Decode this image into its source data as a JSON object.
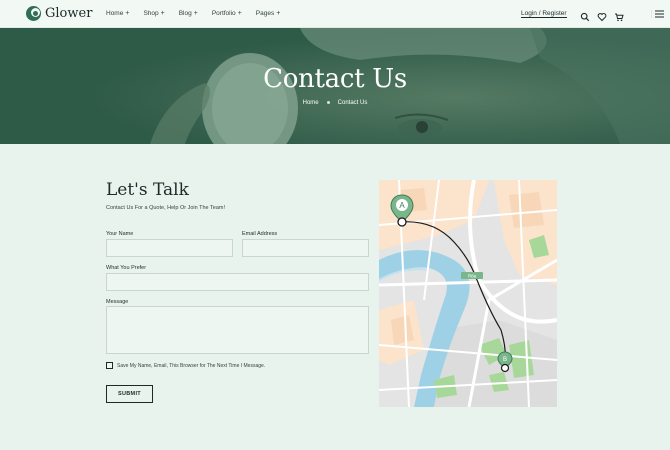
{
  "header": {
    "logo_text": "Glower",
    "nav": [
      {
        "label": "Home",
        "suffix": "+"
      },
      {
        "label": "Shop",
        "suffix": "+"
      },
      {
        "label": "Blog",
        "suffix": "+"
      },
      {
        "label": "Portfolio",
        "suffix": "+"
      },
      {
        "label": "Pages",
        "suffix": "+"
      }
    ],
    "login_label": "Login / Register",
    "icons": [
      "search-icon",
      "heart-icon",
      "cart-icon",
      "menu-icon"
    ]
  },
  "hero": {
    "title": "Contact Us",
    "breadcrumb": [
      "Home",
      "Contact Us"
    ]
  },
  "form": {
    "title": "Let's Talk",
    "subtitle": "Contact Us For a Quote, Help Or Join The Team!",
    "name_label": "Your Name",
    "email_label": "Email Address",
    "prefer_label": "What You Prefer",
    "message_label": "Message",
    "name_value": "",
    "email_value": "",
    "prefer_value": "",
    "message_value": "",
    "checkbox_label": "Save My Name, Email, This Browser for The Next Time I Message.",
    "checkbox_checked": false,
    "submit_label": "SUBMIT"
  },
  "map": {
    "marker_a": "A",
    "marker_b": "B",
    "road_label": "R8a"
  },
  "colors": {
    "brand": "#2f6f55",
    "page_bg": "#e9f3ee",
    "hero_overlay": "#2e5a48"
  }
}
